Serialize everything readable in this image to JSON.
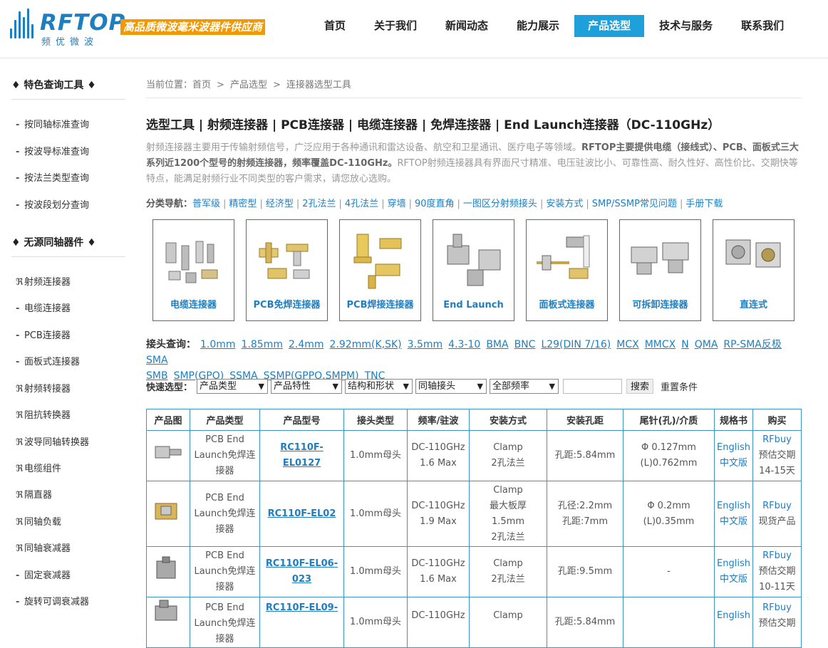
{
  "header": {
    "logo_word": "RFTOP",
    "logo_cn": "频优微波",
    "slogan": "高品质微波毫米波器件供应商",
    "brand_color": "#1f7ec0",
    "nav": [
      {
        "label": "首页",
        "active": false
      },
      {
        "label": "关于我们",
        "active": false
      },
      {
        "label": "新闻动态",
        "active": false
      },
      {
        "label": "能力展示",
        "active": false
      },
      {
        "label": "产品选型",
        "active": true
      },
      {
        "label": "技术与服务",
        "active": false
      },
      {
        "label": "联系我们",
        "active": false
      }
    ]
  },
  "sidebar": {
    "section1_title": "♦ 特色查询工具 ♦",
    "section1_items": [
      "按同轴标准查询",
      "按波导标准查询",
      "按法兰类型查询",
      "按波段划分查询"
    ],
    "section2_title": "♦ 无源同轴器件 ♦",
    "section2_items": [
      {
        "bullet": "ℜ",
        "label": "射频连接器"
      },
      {
        "bullet": "-",
        "label": "电缆连接器"
      },
      {
        "bullet": "-",
        "label": "PCB连接器"
      },
      {
        "bullet": "-",
        "label": "面板式连接器"
      },
      {
        "bullet": "ℜ",
        "label": "射频转接器"
      },
      {
        "bullet": "ℜ",
        "label": "阻抗转换器"
      },
      {
        "bullet": "ℜ",
        "label": "波导同轴转换器"
      },
      {
        "bullet": "ℜ",
        "label": "电缆组件"
      },
      {
        "bullet": "ℜ",
        "label": "隔直器"
      },
      {
        "bullet": "ℜ",
        "label": "同轴负载"
      },
      {
        "bullet": "ℜ",
        "label": "同轴衰减器"
      },
      {
        "bullet": "-",
        "label": "固定衰减器"
      },
      {
        "bullet": "-",
        "label": "旋转可调衰减器"
      }
    ]
  },
  "main": {
    "breadcrumb": {
      "prefix": "当前位置：",
      "items": [
        "首页",
        "产品选型",
        "连接器选型工具"
      ],
      "sep": ">"
    },
    "title": "选型工具 | 射频连接器 | PCB连接器 | 电缆连接器 | 免焊连接器 | End Launch连接器（DC-110GHz）",
    "intro_part1": "射频连接器主要用于传输射频信号，广泛应用于各种通讯和雷达设备、航空和卫星通讯、医疗电子等领域。",
    "intro_bold": "RFTOP主要提供电缆（接线式）、PCB、面板式三大系列近1200个型号的射频连接器，频率覆盖DC-110GHz。",
    "intro_part2": "RFTOP射频连接器具有界面尺寸精准、电压驻波比小、可靠性高、耐久性好、高性价比、交期快等特点，能满足射频行业不同类型的客户需求，请您放心选购。",
    "catnav_label": "分类导航：",
    "catnav": [
      "普军级",
      "精密型",
      "经济型",
      "2孔法兰",
      "4孔法兰",
      "穿墙",
      "90度直角",
      "一图区分射频接头",
      "安装方式",
      "SMP/SSMP常见问题",
      "手册下载"
    ],
    "cards": [
      "电缆连接器",
      "PCB免焊连接器",
      "PCB焊接连接器",
      "End Launch",
      "面板式连接器",
      "可拆卸连接器",
      "直连式"
    ],
    "connector_label": "接头查询：",
    "connectors": [
      "1.0mm",
      "1.85mm",
      "2.4mm",
      "2.92mm(K,SK)",
      "3.5mm",
      "4.3-10",
      "BMA",
      "BNC",
      "L29(DIN 7/16)",
      "MCX",
      "MMCX",
      "N",
      "QMA",
      "RP-SMA反极",
      "SMA",
      "SMB",
      "SMP(GPO)",
      "SSMA",
      "SSMP(GPPO,SMPM)",
      "TNC"
    ],
    "quick_label": "快速选型：",
    "selects": [
      "产品类型",
      "产品特性",
      "结构和形状",
      "同轴接头",
      "全部频率"
    ],
    "search_value": "",
    "search_button": "搜索",
    "reset_button": "重置条件"
  },
  "table": {
    "headers": [
      "产品图",
      "产品类型",
      "产品型号",
      "接头类型",
      "频率/驻波",
      "安装方式",
      "安装孔距",
      "尾针(孔)/介质",
      "规格书",
      "购买"
    ],
    "rows": [
      {
        "type": [
          "PCB End",
          "Launch免焊连",
          "接器"
        ],
        "model": [
          "RC110F-EL0127"
        ],
        "head": "1.0mm母头",
        "freq": [
          "DC-110GHz",
          "1.6 Max"
        ],
        "mount": [
          "Clamp",
          "2孔法兰"
        ],
        "hole": [
          "孔距:5.84mm"
        ],
        "pin": [
          "Φ 0.127mm",
          "(L)0.762mm"
        ],
        "spec": [
          "English",
          "中文版"
        ],
        "buy": [
          "RFbuy",
          "预估交期",
          "14-15天"
        ]
      },
      {
        "type": [
          "PCB End",
          "Launch免焊连",
          "接器"
        ],
        "model": [
          "RC110F-EL02"
        ],
        "head": "1.0mm母头",
        "freq": [
          "DC-110GHz",
          "1.9 Max"
        ],
        "mount": [
          "Clamp",
          "最大板厚",
          "1.5mm",
          "2孔法兰"
        ],
        "hole": [
          "孔径:2.2mm",
          "孔距:7mm"
        ],
        "pin": [
          "Φ 0.2mm",
          "(L)0.35mm"
        ],
        "spec": [
          "English",
          "中文版"
        ],
        "buy": [
          "RFbuy",
          "现货产品"
        ]
      },
      {
        "type": [
          "PCB End",
          "Launch免焊连",
          "接器"
        ],
        "model": [
          "RC110F-EL06-",
          "023"
        ],
        "head": "1.0mm母头",
        "freq": [
          "DC-110GHz",
          "1.6 Max"
        ],
        "mount": [
          "Clamp",
          "2孔法兰"
        ],
        "hole": [
          "孔距:9.5mm"
        ],
        "pin": [
          "-"
        ],
        "spec": [
          "English",
          "中文版"
        ],
        "buy": [
          "RFbuy",
          "预估交期",
          "10-11天"
        ]
      },
      {
        "type": [
          "PCB End",
          "Launch免焊连",
          "接器"
        ],
        "model": [
          "RC110F-EL09-",
          ""
        ],
        "head": "1.0mm母头",
        "freq": [
          "DC-110GHz",
          ""
        ],
        "mount": [
          "Clamp",
          ""
        ],
        "hole": [
          "孔距:5.84mm"
        ],
        "pin": [
          ""
        ],
        "spec": [
          "English",
          ""
        ],
        "buy": [
          "RFbuy",
          "预估交期"
        ]
      }
    ]
  }
}
